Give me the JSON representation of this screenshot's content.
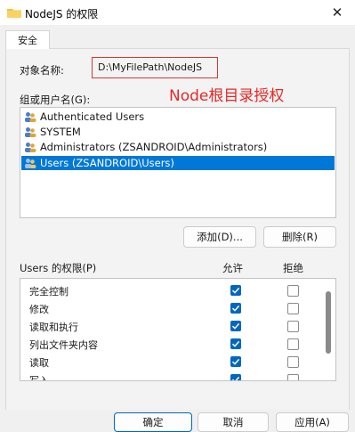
{
  "window": {
    "title": "NodeJS 的权限",
    "close_glyph": "✕"
  },
  "tabs": [
    {
      "label": "安全"
    }
  ],
  "object": {
    "label": "对象名称:",
    "path": "D:\\MyFilePath\\NodeJS"
  },
  "annotation": "Node根目录授权",
  "users_section": {
    "label": "组或用户名(G):",
    "users": [
      {
        "name": "Authenticated Users",
        "icon": "users-group-icon",
        "selected": false
      },
      {
        "name": "SYSTEM",
        "icon": "users-group-icon",
        "selected": false
      },
      {
        "name": "Administrators (ZSANDROID\\Administrators)",
        "icon": "users-group-icon",
        "selected": false
      },
      {
        "name": "Users (ZSANDROID\\Users)",
        "icon": "users-group-icon",
        "selected": true
      }
    ]
  },
  "user_buttons": {
    "add": "添加(D)...",
    "remove": "删除(R)"
  },
  "permissions": {
    "label": "Users 的权限(P)",
    "allow_header": "允许",
    "deny_header": "拒绝",
    "items": [
      {
        "name": "完全控制",
        "allow": true,
        "deny": false
      },
      {
        "name": "修改",
        "allow": true,
        "deny": false
      },
      {
        "name": "读取和执行",
        "allow": true,
        "deny": false
      },
      {
        "name": "列出文件夹内容",
        "allow": true,
        "deny": false
      },
      {
        "name": "读取",
        "allow": true,
        "deny": false
      },
      {
        "name": "写入",
        "allow": true,
        "deny": false
      }
    ]
  },
  "footer": {
    "ok": "确定",
    "cancel": "取消",
    "apply": "应用(A)"
  },
  "colors": {
    "selection": "#0078d7",
    "checkbox": "#0067c0",
    "annotation": "#e82828",
    "highlight_border": "#e03333"
  }
}
